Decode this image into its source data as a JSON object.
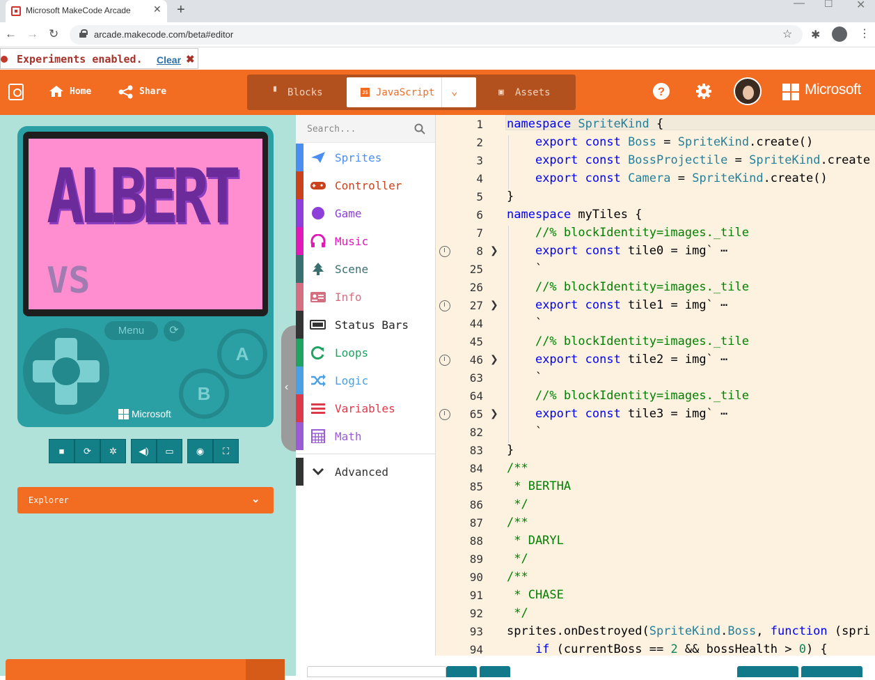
{
  "browser": {
    "tab_title": "Microsoft MakeCode Arcade",
    "url": "arcade.makecode.com/beta#editor",
    "new_tab": "+",
    "tab_close": "✕"
  },
  "banner": {
    "text": "Experiments enabled.",
    "clear_label": "Clear",
    "close_glyph": "✖"
  },
  "header": {
    "home_label": "Home",
    "share_label": "Share",
    "modes": {
      "blocks": "Blocks",
      "javascript": "JavaScript",
      "assets": "Assets"
    },
    "brand": "Microsoft",
    "accent": "#f26c22"
  },
  "simulator": {
    "screen_line1": "ALBERT",
    "screen_line2": "VS",
    "menu_label": "Menu",
    "a_label": "A",
    "b_label": "B",
    "brand": "Microsoft",
    "explorer_label": "Explorer"
  },
  "toolbox": {
    "search_placeholder": "Search...",
    "categories": [
      {
        "label": "Sprites",
        "color": "#4b8ef0",
        "icon": "paper-plane-icon"
      },
      {
        "label": "Controller",
        "color": "#c9421b",
        "icon": "gamepad-icon"
      },
      {
        "label": "Game",
        "color": "#8f3fd9",
        "icon": "circle-icon"
      },
      {
        "label": "Music",
        "color": "#e01ab6",
        "icon": "headphones-icon"
      },
      {
        "label": "Scene",
        "color": "#3a6f70",
        "icon": "tree-icon"
      },
      {
        "label": "Info",
        "color": "#d36f81",
        "icon": "id-card-icon"
      },
      {
        "label": "Status Bars",
        "color": "#333333",
        "icon": "battery-icon"
      },
      {
        "label": "Loops",
        "color": "#20a361",
        "icon": "refresh-icon"
      },
      {
        "label": "Logic",
        "color": "#4aa0e2",
        "icon": "shuffle-icon"
      },
      {
        "label": "Variables",
        "color": "#dc3a4a",
        "icon": "list-icon"
      },
      {
        "label": "Math",
        "color": "#9a5cd5",
        "icon": "calculator-icon"
      }
    ],
    "advanced_label": "Advanced"
  },
  "code_lines": [
    {
      "n": "1",
      "html": "<span class='k'>namespace</span> <span class='t'>SpriteKind</span> {"
    },
    {
      "n": "2",
      "html": "    <span class='k'>export</span> <span class='k'>const</span> <span class='t'>Boss</span> = <span class='t'>SpriteKind</span>.create()"
    },
    {
      "n": "3",
      "html": "    <span class='k'>export</span> <span class='k'>const</span> <span class='t'>BossProjectile</span> = <span class='t'>SpriteKind</span>.create"
    },
    {
      "n": "4",
      "html": "    <span class='k'>export</span> <span class='k'>const</span> <span class='t'>Camera</span> = <span class='t'>SpriteKind</span>.create()"
    },
    {
      "n": "5",
      "html": "}"
    },
    {
      "n": "6",
      "html": "<span class='k'>namespace</span> myTiles {"
    },
    {
      "n": "7",
      "html": "    <span class='cm'>//% blockIdentity=images._tile</span>"
    },
    {
      "n": "8",
      "html": "    <span class='k'>export</span> <span class='k'>const</span> tile0 = img` ⋯",
      "fold": true
    },
    {
      "n": "25",
      "html": "    `"
    },
    {
      "n": "26",
      "html": "    <span class='cm'>//% blockIdentity=images._tile</span>"
    },
    {
      "n": "27",
      "html": "    <span class='k'>export</span> <span class='k'>const</span> tile1 = img` ⋯",
      "fold": true
    },
    {
      "n": "44",
      "html": "    `"
    },
    {
      "n": "45",
      "html": "    <span class='cm'>//% blockIdentity=images._tile</span>"
    },
    {
      "n": "46",
      "html": "    <span class='k'>export</span> <span class='k'>const</span> tile2 = img` ⋯",
      "fold": true
    },
    {
      "n": "63",
      "html": "    `"
    },
    {
      "n": "64",
      "html": "    <span class='cm'>//% blockIdentity=images._tile</span>"
    },
    {
      "n": "65",
      "html": "    <span class='k'>export</span> <span class='k'>const</span> tile3 = img` ⋯",
      "fold": true
    },
    {
      "n": "82",
      "html": "    `"
    },
    {
      "n": "83",
      "html": "}"
    },
    {
      "n": "84",
      "html": "<span class='cm'>/**</span>"
    },
    {
      "n": "85",
      "html": "<span class='cm'> * BERTHA</span>"
    },
    {
      "n": "86",
      "html": "<span class='cm'> */</span>"
    },
    {
      "n": "87",
      "html": "<span class='cm'>/**</span>"
    },
    {
      "n": "88",
      "html": "<span class='cm'> * DARYL</span>"
    },
    {
      "n": "89",
      "html": "<span class='cm'> */</span>"
    },
    {
      "n": "90",
      "html": "<span class='cm'>/**</span>"
    },
    {
      "n": "91",
      "html": "<span class='cm'> * CHASE</span>"
    },
    {
      "n": "92",
      "html": "<span class='cm'> */</span>"
    },
    {
      "n": "93",
      "html": "sprites.onDestroyed(<span class='t'>SpriteKind</span>.<span class='t'>Boss</span>, <span class='k'>function</span> (spri"
    },
    {
      "n": "94",
      "html": "    <span class='k'>if</span> (currentBoss == <span class='n'>2</span> &amp;&amp; bossHealth &gt; <span class='n'>0</span>) {"
    }
  ]
}
